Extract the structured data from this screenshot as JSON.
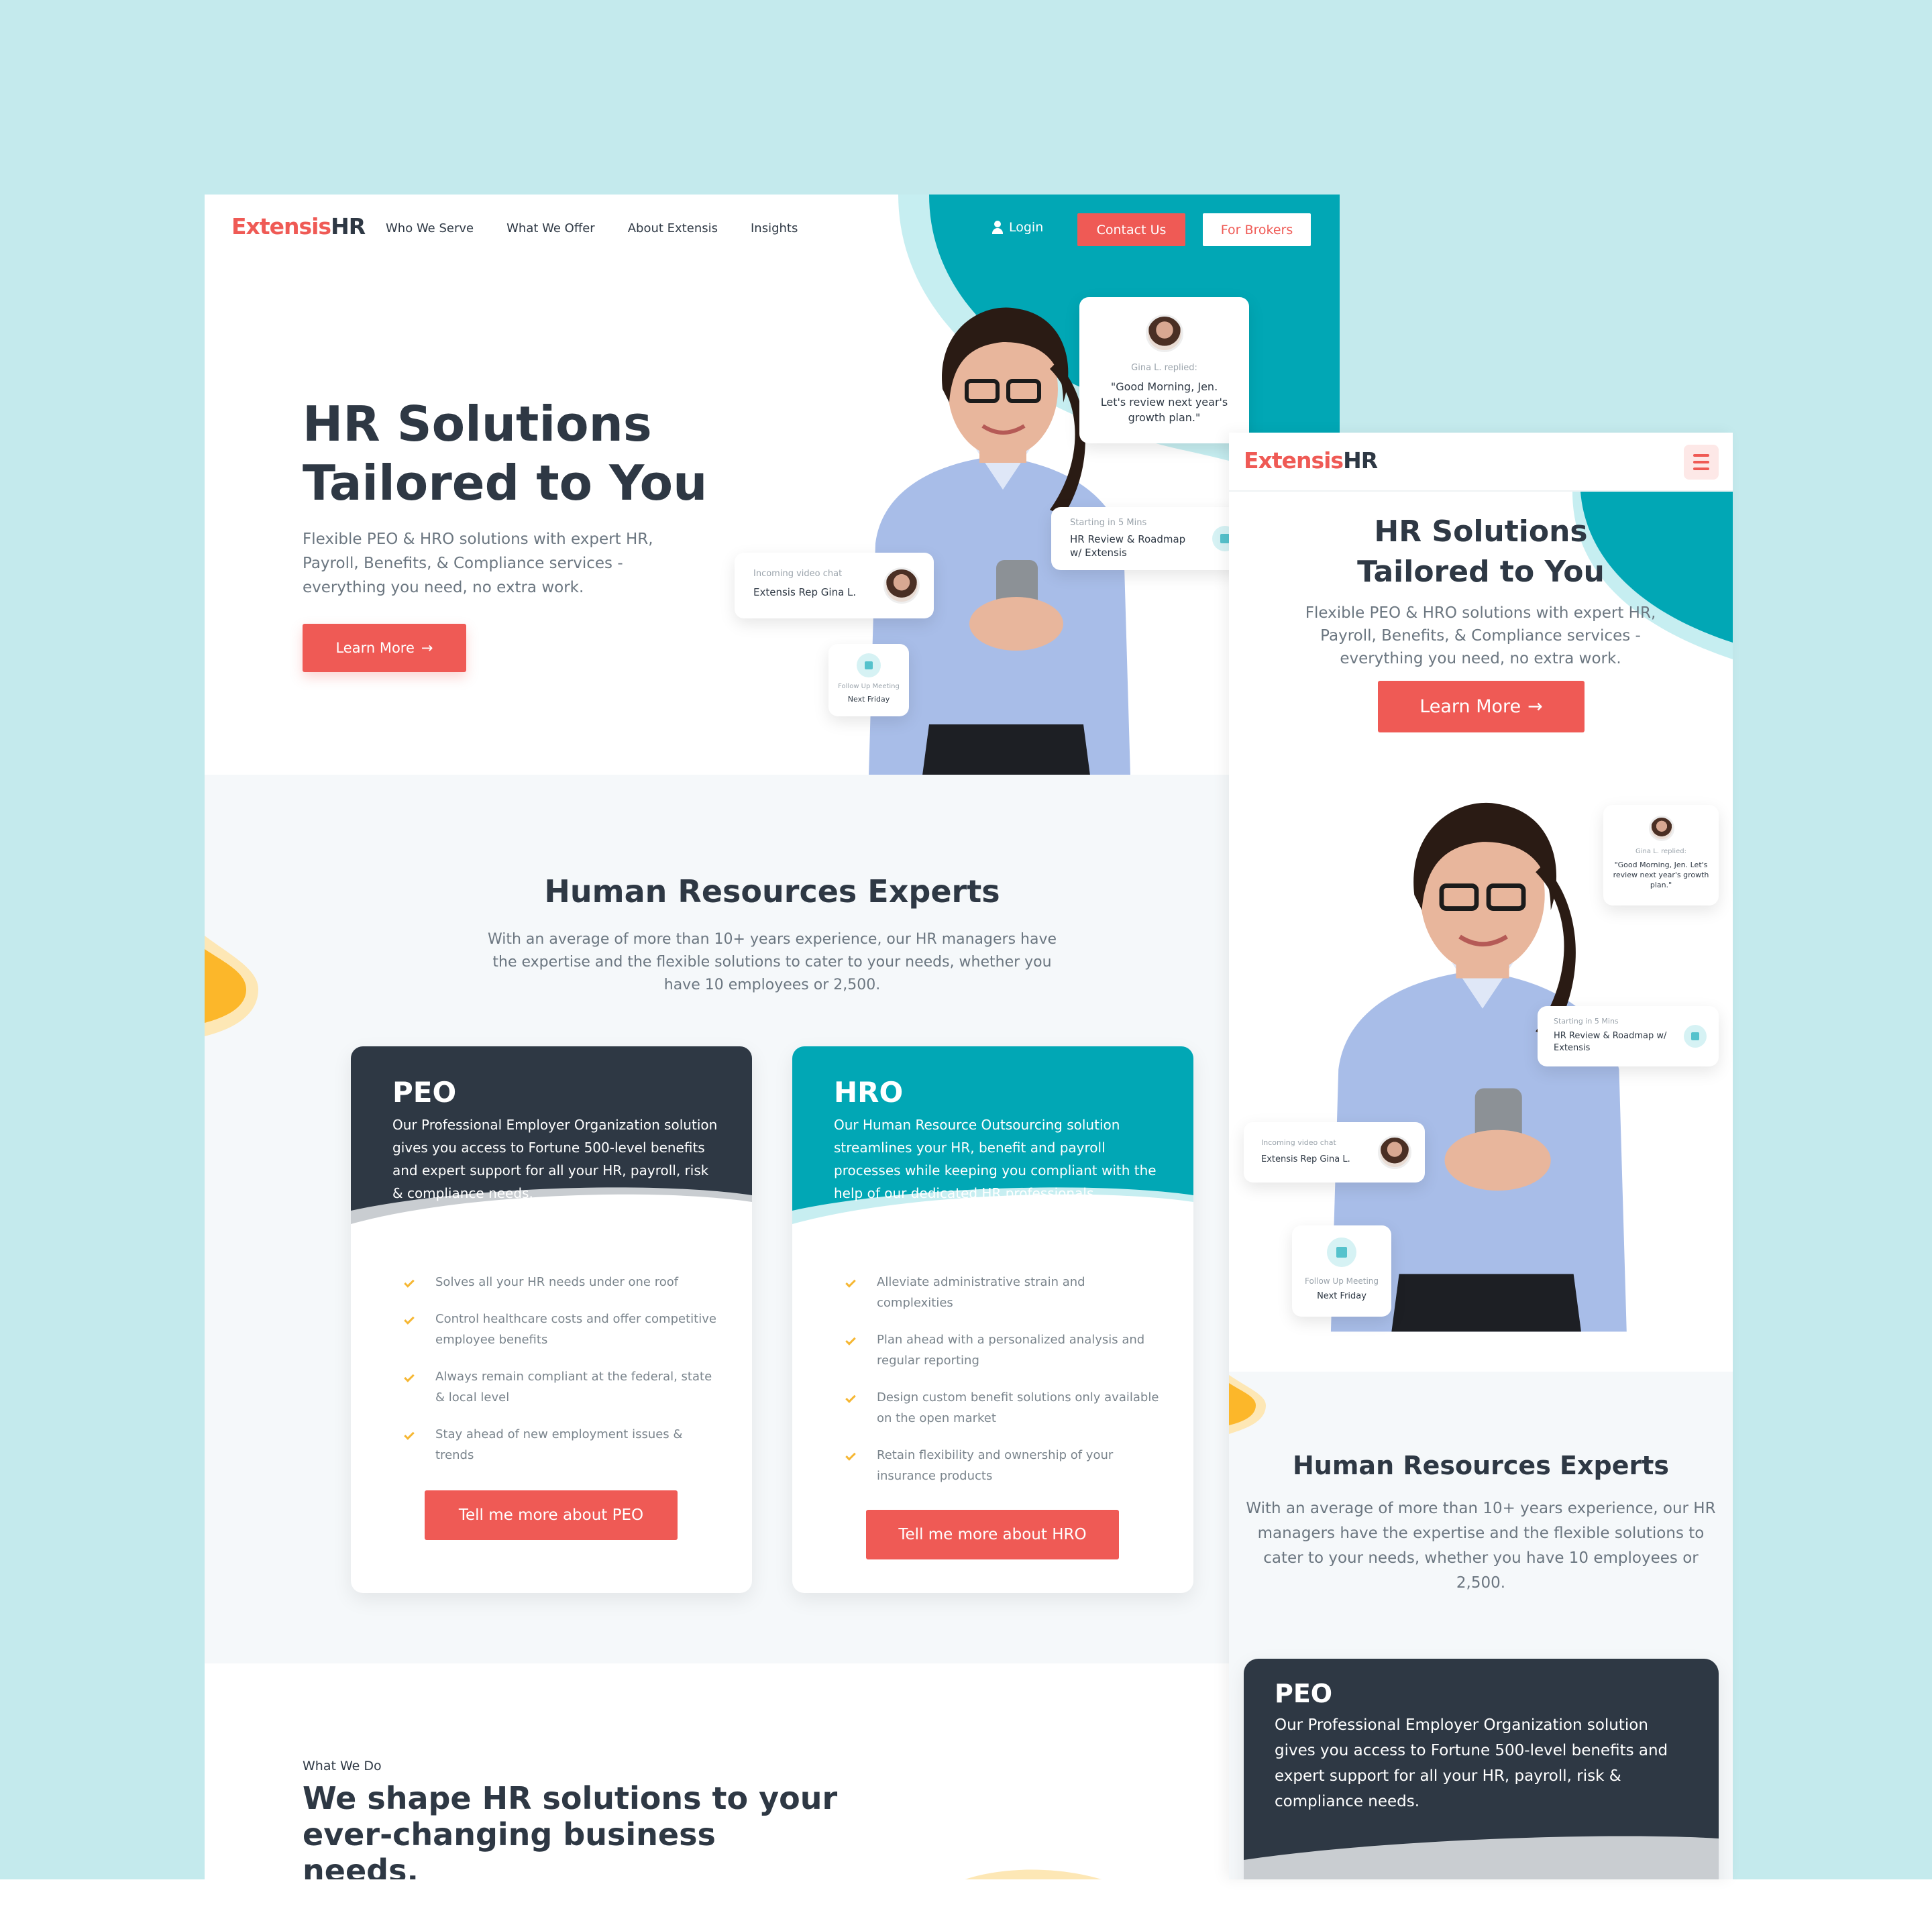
{
  "brand": {
    "logo_accent": "Extensis",
    "logo_main": "HR",
    "accent_color": "#ef5a55",
    "teal_color": "#01a7b5",
    "dark_color": "#2e3844",
    "yellow_color": "#fcb72a"
  },
  "nav": {
    "links": [
      "Who We Serve",
      "What We Offer",
      "About Extensis",
      "Insights"
    ],
    "login": "Login",
    "contact": "Contact Us",
    "brokers": "For Brokers"
  },
  "hero": {
    "title_line1": "HR Solutions",
    "title_line2": "Tailored to You",
    "subtitle": "Flexible PEO & HRO solutions with expert HR, Payroll, Benefits, & Compliance services - everything you need, no extra work.",
    "cta": "Learn More",
    "cta_icon": "arrow-right-icon"
  },
  "floating_cards": {
    "reply_name": "Gina L. replied:",
    "reply_text": "\"Good Morning, Jen. Let's review next year's growth plan.\"",
    "meeting_time": "Starting in 5 Mins",
    "meeting_title": "HR Review & Roadmap w/ Extensis",
    "chat_label": "Incoming video chat",
    "chat_name": "Extensis Rep Gina L.",
    "followup_label": "Follow Up Meeting",
    "followup_date": "Next Friday"
  },
  "experts": {
    "title": "Human Resources Experts",
    "text": "With an average of more than 10+ years experience, our HR managers have the expertise and the flexible solutions to cater to your needs, whether you have 10 employees or 2,500."
  },
  "peo": {
    "title": "PEO",
    "desc": "Our Professional Employer Organization solution gives you access to Fortune 500-level benefits and expert support for all your HR, payroll, risk & compliance needs.",
    "items": [
      "Solves all your HR needs under one roof",
      "Control healthcare costs and offer competitive employee benefits",
      "Always remain compliant at the federal, state & local level",
      "Stay ahead of new employment issues & trends"
    ],
    "cta": "Tell me more about PEO"
  },
  "hro": {
    "title": "HRO",
    "desc": "Our Human Resource Outsourcing solution streamlines your HR, benefit and payroll processes while keeping you compliant with the help of our dedicated HR professionals.",
    "items": [
      "Alleviate administrative strain and complexities",
      "Plan ahead with a personalized analysis and regular reporting",
      "Design custom benefit solutions only available on the open market",
      "Retain flexibility and ownership of your insurance products"
    ],
    "cta": "Tell me more about HRO"
  },
  "what_we_do": {
    "label": "What We Do",
    "title": "We shape HR solutions to your ever-changing business needs."
  }
}
